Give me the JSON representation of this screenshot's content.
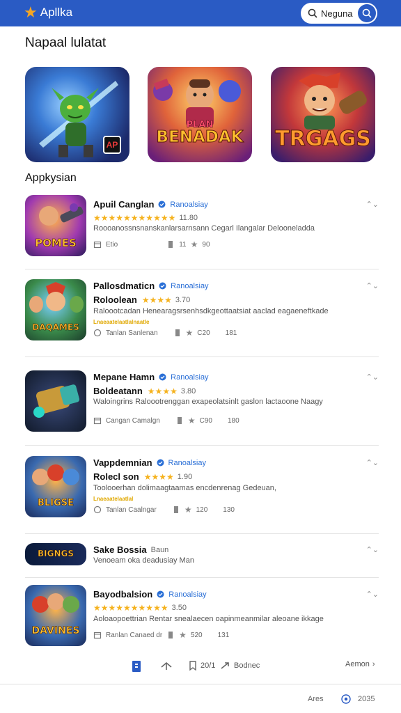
{
  "header": {
    "brand_name": "Apllka",
    "brand_icon": "star-icon",
    "search_label": "Neguna",
    "accent_color": "#2a5bc4"
  },
  "featured": {
    "title": "Napaal lulatat",
    "cards": [
      {
        "label": "",
        "badge": "AP"
      },
      {
        "label_top": "PLAN",
        "label": "BENADAK"
      },
      {
        "label": "TRGAGS"
      }
    ]
  },
  "list": {
    "title": "Appkysian",
    "apps": [
      {
        "name": "Apuil Canglan",
        "developer": "Ranoalsiay",
        "subtitle": "",
        "stars": "★★★★★★★★★★★",
        "rating": "11.80",
        "description": "Roooanossnsnanskanlarsarnsann Cegarl Ilangalar Delooneladda",
        "tag": "",
        "meta_left": "Etio",
        "meta_count": "11",
        "meta_rating": "90",
        "meta_extra": "",
        "icon_label": "POMES"
      },
      {
        "name": "Pallosdmaticn",
        "developer": "Ranoalsiay",
        "subtitle": "Roloolean",
        "stars": "★★★★",
        "rating": "3.70",
        "description": "Raloootcadan Henearagsrsenhsdkgeottaatsiat aaclad eagaeneftkade",
        "tag": "Lnaeaatelaatlalnaatle",
        "meta_left": "Tanlan Sanlenan",
        "meta_count": "",
        "meta_rating": "C20",
        "meta_extra": "181",
        "icon_label": "DAQAMES"
      },
      {
        "name": "Mepane Hamn",
        "developer": "Ranoalsiay",
        "subtitle": "Boldeatann",
        "stars": "★★★★",
        "rating": "3.80",
        "description": "Waloingrins Raloootrenggan exapeolatsinlt gaslon lactaoone Naagy",
        "tag": "",
        "meta_left": "Cangan Camalgn",
        "meta_count": "",
        "meta_rating": "C90",
        "meta_extra": "180",
        "icon_label": ""
      },
      {
        "name": "Vappdemnian",
        "developer": "Ranoalsiay",
        "subtitle": "Rolecl son",
        "stars": "★★★★",
        "rating": "1.90",
        "description": "Toolooerhan dolimaagtaamas encdenrenag Gedeuan,",
        "tag": "Lnaeaatelaatlal",
        "meta_left": "Tanlan Caalngar",
        "meta_count": "",
        "meta_rating": "120",
        "meta_extra": "130",
        "icon_label": "BLIGSE"
      },
      {
        "name": "Sake Bossia",
        "developer": "",
        "subtitle": "",
        "stars": "",
        "rating": "",
        "description": "Venoeam oka deadusiay Man",
        "tag": "",
        "meta_left": "",
        "meta_count": "",
        "meta_rating": "",
        "meta_extra": "",
        "icon_label": "BIGNGS",
        "inline_note": "Baun"
      },
      {
        "name": "Bayodbalsion",
        "developer": "Ranoalsiay",
        "subtitle": "",
        "stars": "★★★★★★★★★★",
        "rating": "3.50",
        "description": "Aoloaopoettrian Rentar snealaecen oapinmeanmilar aleoane ikkage",
        "tag": "",
        "meta_left": "Ranlan Canaed dr",
        "meta_count": "",
        "meta_rating": "520",
        "meta_extra": "131",
        "icon_label": "DAVINES"
      }
    ]
  },
  "bottom_nav": {
    "item_text_1": "20/1",
    "item_text_2": "Bodnec",
    "right_label": "Aemon"
  },
  "footer": {
    "left": "Ares",
    "right": "2035"
  }
}
